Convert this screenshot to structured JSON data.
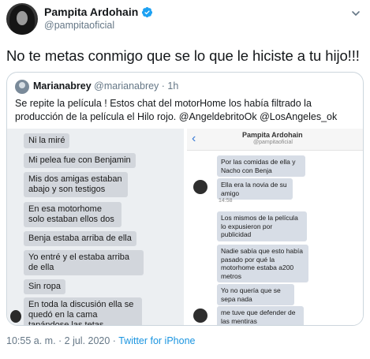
{
  "tweet": {
    "display_name": "Pampita Ardohain",
    "handle": "@pampitaoficial",
    "text": "No te metas conmigo que se lo que le hiciste a tu hijo!!!",
    "date": "10:55 a. m. · 2 jul. 2020 · ",
    "source": "Twitter for iPhone"
  },
  "quoted": {
    "name": "Marianabrey",
    "handle": "@marianabrey",
    "time": "· 1h",
    "text": "Se repite la película ! Estos chat del motorHome los había filtrado la producción de la película el Hilo rojo.  @AngeldebritoOk @LosAngeles_ok"
  },
  "chat_left": {
    "messages": [
      "Ni la miré",
      "Mi pelea fue con Benjamin",
      "Mis dos amigas estaban abajo y son testigos",
      "En esa motorhome solo estaban ellos dos",
      "Benja estaba arriba de ella",
      "Yo entré y el estaba arriba de ella",
      "Sin ropa",
      "En toda la discusión ella se quedó en la cama tapándose las tetas"
    ]
  },
  "chat_right": {
    "title": "Pampita Ardohain",
    "subtitle": "@pampitaoficial",
    "time": "14:58",
    "messages": [
      "Por las comidas de ella y Nacho con Benja",
      "Ella era la novia de su amigo",
      "Los mismos de la película lo expusieron por publicidad",
      "Nadie sabía que esto había pasado por qué la motorhome estaba a200 metros",
      "Yo no quería que se sepa nada",
      "me tuve que defender de las mentiras"
    ]
  },
  "colors": {
    "verified": "#1da1f2",
    "link": "#1b95e0",
    "muted": "#657786"
  }
}
